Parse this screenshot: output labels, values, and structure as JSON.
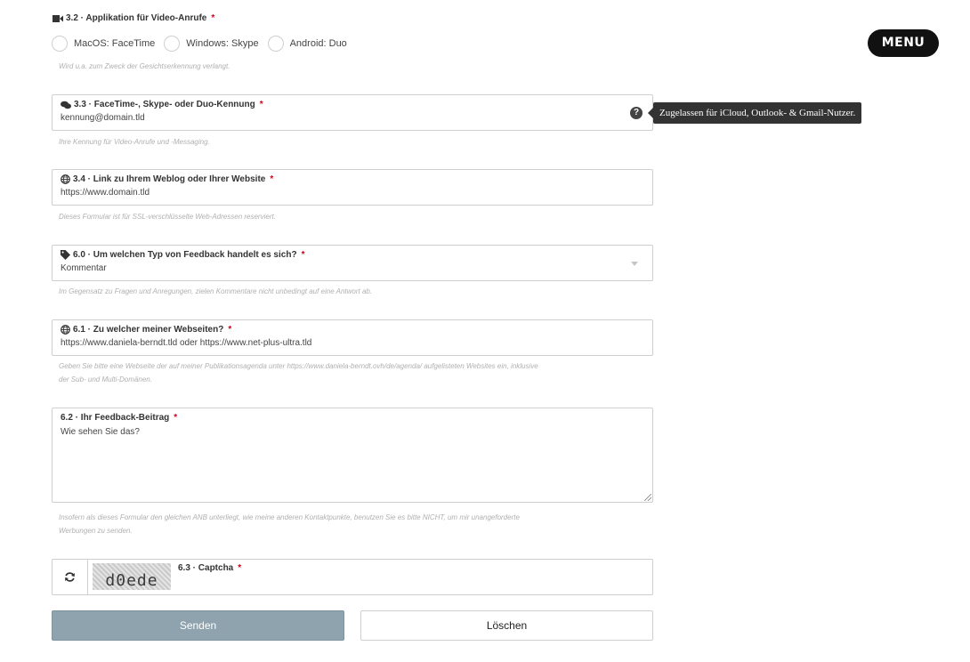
{
  "video_app": {
    "label": "3.2 · Applikation für Video-Anrufe",
    "required": "*",
    "options": [
      "MacOS: FaceTime",
      "Windows: Skype",
      "Android: Duo"
    ],
    "help": "Wird u.a. zum Zweck der Gesichtserkennung verlangt."
  },
  "menu": {
    "label": "MENU"
  },
  "facetime_id": {
    "label": "3.3 · FaceTime-, Skype- oder Duo-Kennung",
    "required": "*",
    "value": "kennung@domain.tld",
    "help": "Ihre Kennung für Video-Anrufe und -Messaging.",
    "help_icon": "?",
    "tooltip": "Zugelassen für iCloud, Outlook- & Gmail-Nutzer."
  },
  "website": {
    "label": "3.4 · Link zu Ihrem Weblog oder Ihrer Website",
    "required": "*",
    "value": "https://www.domain.tld",
    "help": "Dieses Formular ist für SSL-verschlüsselte Web-Adressen reserviert."
  },
  "feedback_type": {
    "label": "6.0 · Um welchen Typ von Feedback handelt es sich?",
    "required": "*",
    "value": "Kommentar",
    "help": "Im Gegensatz zu Fragen und Anregungen, zielen Kommentare nicht unbedingt auf eine Antwort ab."
  },
  "which_site": {
    "label": "6.1 · Zu welcher meiner Webseiten?",
    "required": "*",
    "value": "https://www.daniela-berndt.tld oder https://www.net-plus-ultra.tld",
    "help_line1": "Geben Sie bitte eine Webseite der auf meiner Publikationsagenda unter https://www.daniela-berndt.ovh/de/agenda/ aufgelisteten Websites ein, inklusive",
    "help_line2": "der Sub- und Multi-Domänen."
  },
  "feedback_text": {
    "label": "6.2 · Ihr Feedback-Beitrag",
    "required": "*",
    "value": "Wie sehen Sie das?",
    "help_line1": "Insofern als dieses Formular den gleichen ANB unterliegt, wie meine anderen Kontaktpunkte, benutzen Sie es bitte NICHT, um mir unangeforderte",
    "help_line2": "Werbungen zu senden."
  },
  "captcha": {
    "label": "6.3 · Captcha",
    "required": "*",
    "code": "d0ede"
  },
  "buttons": {
    "send": "Senden",
    "clear": "Löschen"
  },
  "icons": [
    "video-camera-icon",
    "chat-bubbles-icon",
    "globe-icon",
    "tag-icon",
    "refresh-icon",
    "question-icon",
    "dropdown-arrow-icon",
    "resize-handle-icon"
  ],
  "colors": {
    "required": "#d0021b",
    "send_button": "#8ea3ad",
    "menu": "#111111",
    "tooltip": "#333333"
  }
}
